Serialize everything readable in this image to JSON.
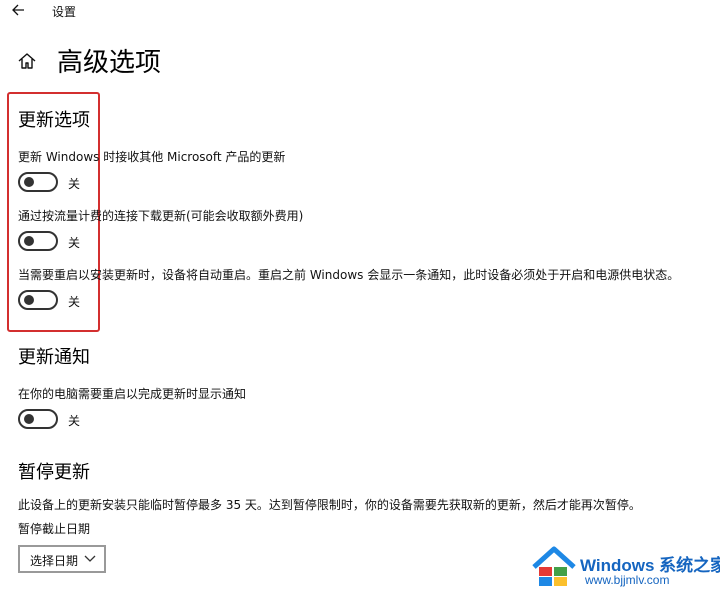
{
  "header": {
    "app_title": "设置"
  },
  "page": {
    "title": "高级选项"
  },
  "update_options": {
    "title": "更新选项",
    "items": [
      {
        "label": "更新 Windows 时接收其他 Microsoft 产品的更新",
        "state": "关"
      },
      {
        "label": "通过按流量计费的连接下载更新(可能会收取额外费用)",
        "state": "关"
      },
      {
        "label": "当需要重启以安装更新时，设备将自动重启。重启之前 Windows 会显示一条通知，此时设备必须处于开启和电源供电状态。",
        "state": "关"
      }
    ]
  },
  "update_notifications": {
    "title": "更新通知",
    "items": [
      {
        "label": "在你的电脑需要重启以完成更新时显示通知",
        "state": "关"
      }
    ]
  },
  "pause_updates": {
    "title": "暂停更新",
    "description": "此设备上的更新安装只能临时暂停最多 35 天。达到暂停限制时，你的设备需要先获取新的更新，然后才能再次暂停。",
    "date_label": "暂停截止日期",
    "date_select": "选择日期"
  },
  "watermark": {
    "brand": "Windows 系统之家",
    "site": "www.bjjmlv.com"
  },
  "colors": {
    "highlight": "#d32f2f",
    "watermark": "#1565c0"
  }
}
